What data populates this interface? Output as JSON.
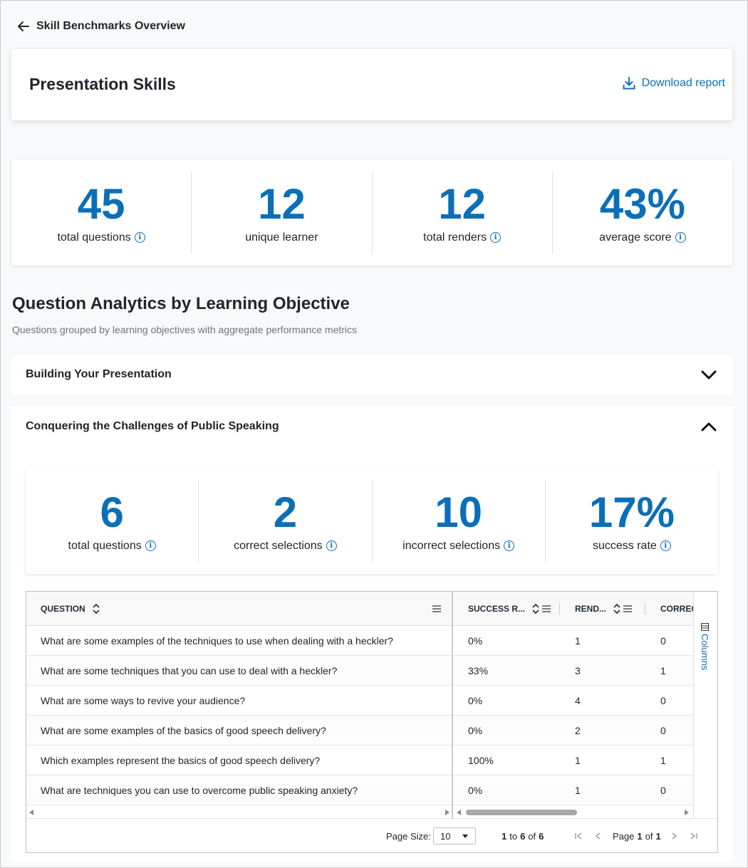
{
  "nav": {
    "back_label": "Skill Benchmarks Overview"
  },
  "header": {
    "title": "Presentation Skills",
    "download_label": "Download report"
  },
  "overview_stats": [
    {
      "value": "45",
      "label": "total questions",
      "info": true
    },
    {
      "value": "12",
      "label": "unique learner",
      "info": false
    },
    {
      "value": "12",
      "label": "total renders",
      "info": true
    },
    {
      "value": "43%",
      "label": "average score",
      "info": true
    }
  ],
  "section": {
    "title": "Question Analytics by Learning Objective",
    "subtitle": "Questions grouped by learning objectives with aggregate performance metrics"
  },
  "accordions": [
    {
      "title": "Building Your Presentation",
      "expanded": false
    },
    {
      "title": "Conquering the Challenges of Public Speaking",
      "expanded": true
    }
  ],
  "objective_stats": [
    {
      "value": "6",
      "label": "total questions"
    },
    {
      "value": "2",
      "label": "correct selections"
    },
    {
      "value": "10",
      "label": "incorrect selections"
    },
    {
      "value": "17%",
      "label": "success rate"
    }
  ],
  "grid": {
    "columns": [
      "QUESTION",
      "SUCCESS R...",
      "REND...",
      "CORREC"
    ],
    "rows": [
      [
        "What are some examples of the techniques to use when dealing with a heckler?",
        "0%",
        "1",
        "0"
      ],
      [
        "What are some techniques that you can use to deal with a heckler?",
        "33%",
        "3",
        "1"
      ],
      [
        "What are some ways to revive your audience?",
        "0%",
        "4",
        "0"
      ],
      [
        "What are some examples of the basics of good speech delivery?",
        "0%",
        "2",
        "0"
      ],
      [
        "Which examples represent the basics of good speech delivery?",
        "100%",
        "1",
        "1"
      ],
      [
        "What are techniques you can use to overcome public speaking anxiety?",
        "0%",
        "1",
        "0"
      ]
    ],
    "side_panel_label": "Columns",
    "pagination": {
      "page_size_label": "Page Size:",
      "page_size_value": "10",
      "range_from": "1",
      "range_to_word": "to",
      "range_to": "6",
      "range_of_word": "of",
      "range_total": "6",
      "page_word": "Page",
      "page_current": "1",
      "page_of_word": "of",
      "page_total": "1"
    }
  },
  "colors": {
    "accent": "#0b6fb8",
    "text": "#212529",
    "muted": "#6c757d"
  }
}
